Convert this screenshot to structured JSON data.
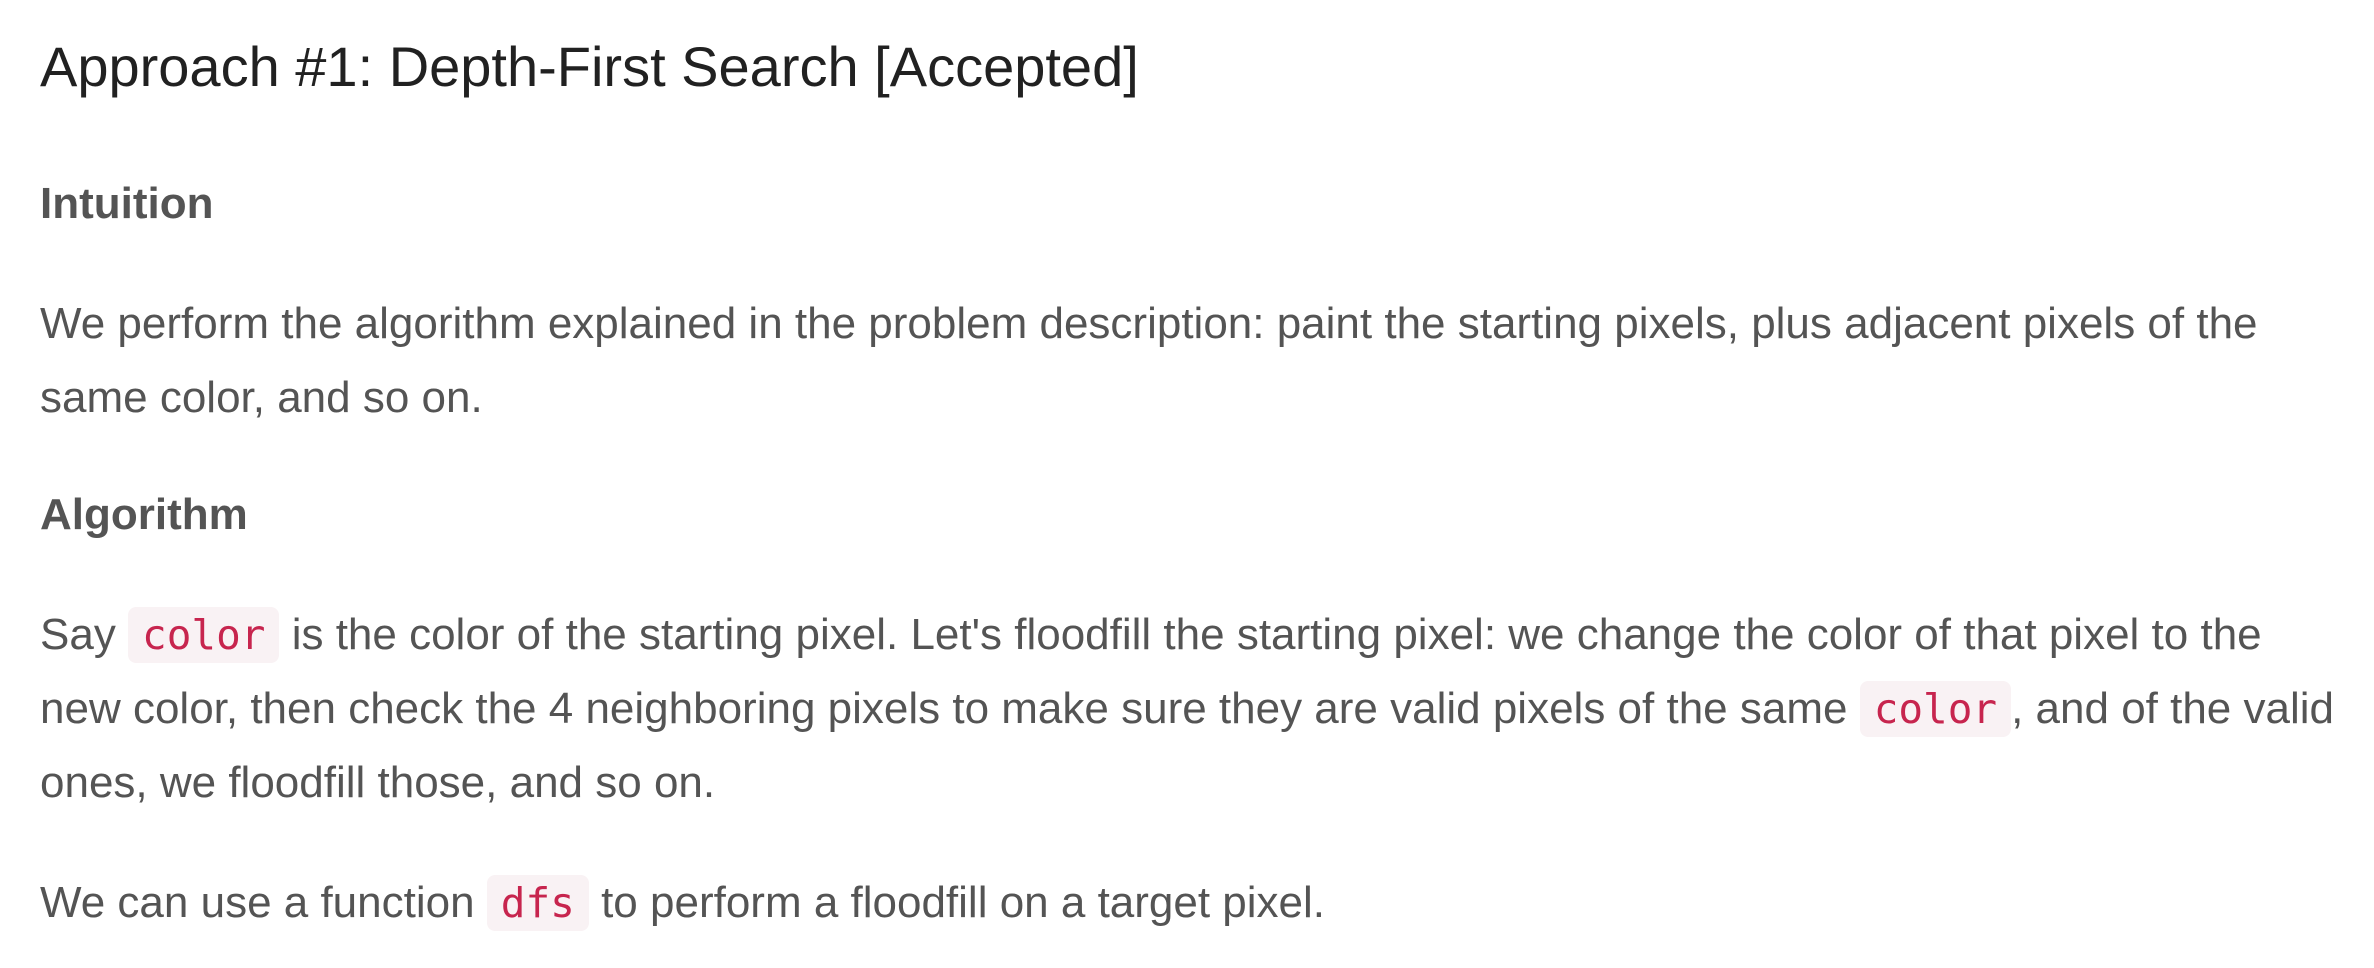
{
  "article": {
    "title": "Approach #1: Depth-First Search [Accepted]",
    "intuition": {
      "heading": "Intuition",
      "text": "We perform the algorithm explained in the problem description: paint the starting pixels, plus adjacent pixels of the same color, and so on."
    },
    "algorithm": {
      "heading": "Algorithm",
      "p1": {
        "t1": "Say ",
        "code1": "color",
        "t2": " is the color of the starting pixel. Let's floodfill the starting pixel: we change the color of that pixel to the new color, then check the 4 neighboring pixels to make sure they are valid pixels of the same ",
        "code2": "color",
        "t3": ", and of the valid ones, we floodfill those, and so on."
      },
      "p2": {
        "t1": "We can use a function ",
        "code1": "dfs",
        "t2": " to perform a floodfill on a target pixel."
      }
    }
  }
}
